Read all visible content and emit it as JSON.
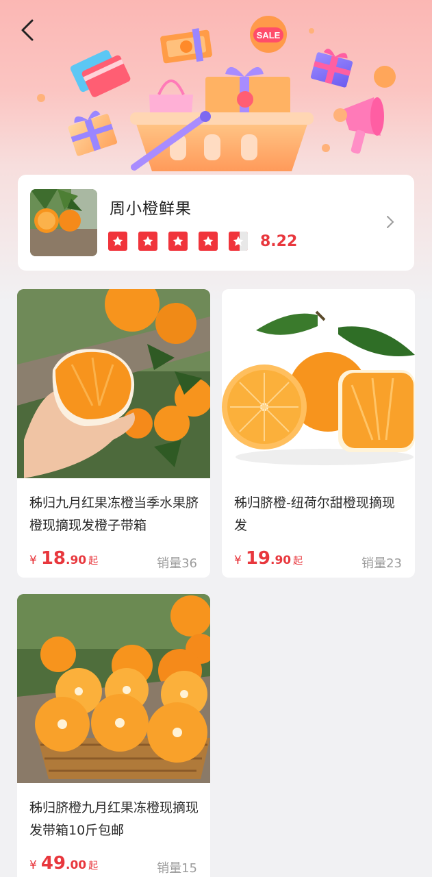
{
  "header": {
    "back_icon": "chevron-left-icon",
    "banner_sale_badge": "SALE"
  },
  "shop": {
    "name": "周小橙鲜果",
    "rating_stars": 4.5,
    "rating_max": 5,
    "score": "8.22",
    "arrow_icon": "chevron-right-icon"
  },
  "products": [
    {
      "title": "秭归九月红果冻橙当季水果脐橙现摘现发橙子带箱",
      "price_symbol": "¥",
      "price_int": "18",
      "price_dec": ".90",
      "price_suffix": "起",
      "sales": "销量36"
    },
    {
      "title": "秭归脐橙-纽荷尔甜橙现摘现发",
      "price_symbol": "¥",
      "price_int": "19",
      "price_dec": ".90",
      "price_suffix": "起",
      "sales": "销量23"
    },
    {
      "title": "秭归脐橙九月红果冻橙现摘现发带箱10斤包邮",
      "price_symbol": "¥",
      "price_int": "49",
      "price_dec": ".00",
      "price_suffix": "起",
      "sales": "销量15"
    }
  ],
  "colors": {
    "accent": "#e8373d",
    "star": "#f0343b",
    "orange": "#f7941d"
  }
}
